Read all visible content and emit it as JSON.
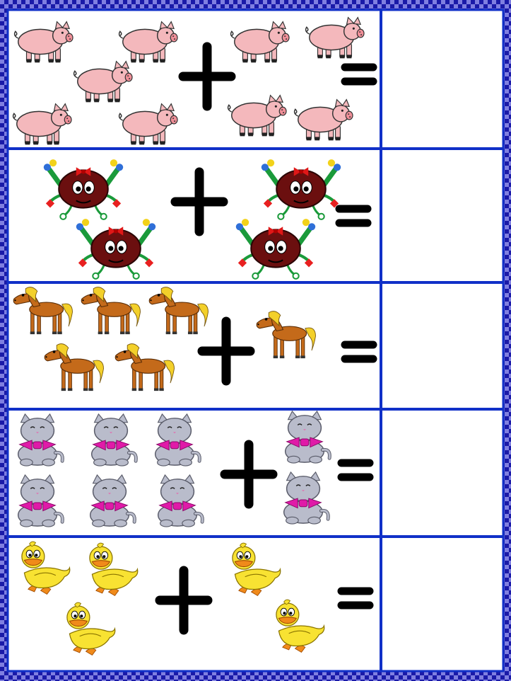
{
  "worksheet": {
    "border_color": "#1a1aa8",
    "border_check_color": "#7f7fe0",
    "grid_line_color": "#1030c8",
    "symbol_color": "#000000"
  },
  "rows": [
    {
      "animal": "pig",
      "icon": "pig-icon",
      "left_count": 5,
      "right_count": 4,
      "operator": "plus",
      "equals": "equals",
      "answer": ""
    },
    {
      "animal": "ladybug",
      "icon": "ladybug-icon",
      "left_count": 2,
      "right_count": 2,
      "operator": "plus",
      "equals": "equals",
      "answer": ""
    },
    {
      "animal": "horse",
      "icon": "horse-icon",
      "left_count": 5,
      "right_count": 1,
      "operator": "plus",
      "equals": "equals",
      "answer": ""
    },
    {
      "animal": "cat",
      "icon": "cat-icon",
      "left_count": 6,
      "right_count": 2,
      "operator": "plus",
      "equals": "equals",
      "answer": ""
    },
    {
      "animal": "duck",
      "icon": "duck-icon",
      "left_count": 3,
      "right_count": 2,
      "operator": "plus",
      "equals": "equals",
      "answer": ""
    }
  ]
}
